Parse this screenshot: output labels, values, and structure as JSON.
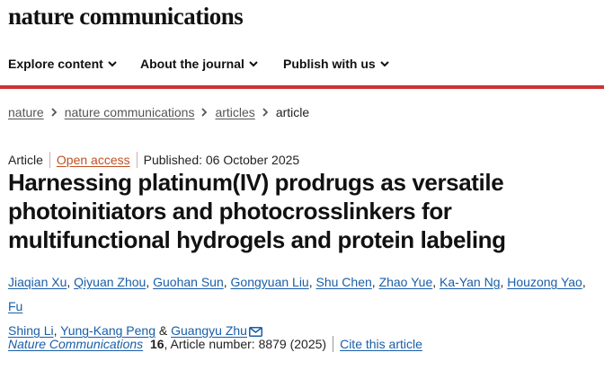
{
  "site": {
    "brand": "nature communications"
  },
  "nav": {
    "explore": "Explore content",
    "about": "About the journal",
    "publish": "Publish with us"
  },
  "breadcrumb": {
    "items": [
      "nature",
      "nature communications",
      "articles"
    ],
    "current": "article"
  },
  "article": {
    "type": "Article",
    "access": "Open access",
    "published": "Published: 06 October 2025",
    "title": "Harnessing platinum(IV) prodrugs as versatile photoinitiators and photocrosslinkers for multifunctional hydrogels and protein labeling",
    "authors": [
      "Jiaqian Xu",
      "Qiyuan Zhou",
      "Guohan Sun",
      "Gongyuan Liu",
      "Shu Chen",
      "Zhao Yue",
      "Ka-Yan Ng",
      "Houzong Yao",
      "Fu",
      "Shing Li",
      "Yung-Kang Peng",
      "Guangyu Zhu"
    ],
    "author_conj": "&",
    "journal": "Nature Communications",
    "volume": "16",
    "article_number": ", Article number: 8879 (2025)",
    "cite_label": "Cite this article"
  },
  "colors": {
    "accent_rule": "#cc3333",
    "link": "#1a5ea8",
    "open_access": "#c05020"
  }
}
